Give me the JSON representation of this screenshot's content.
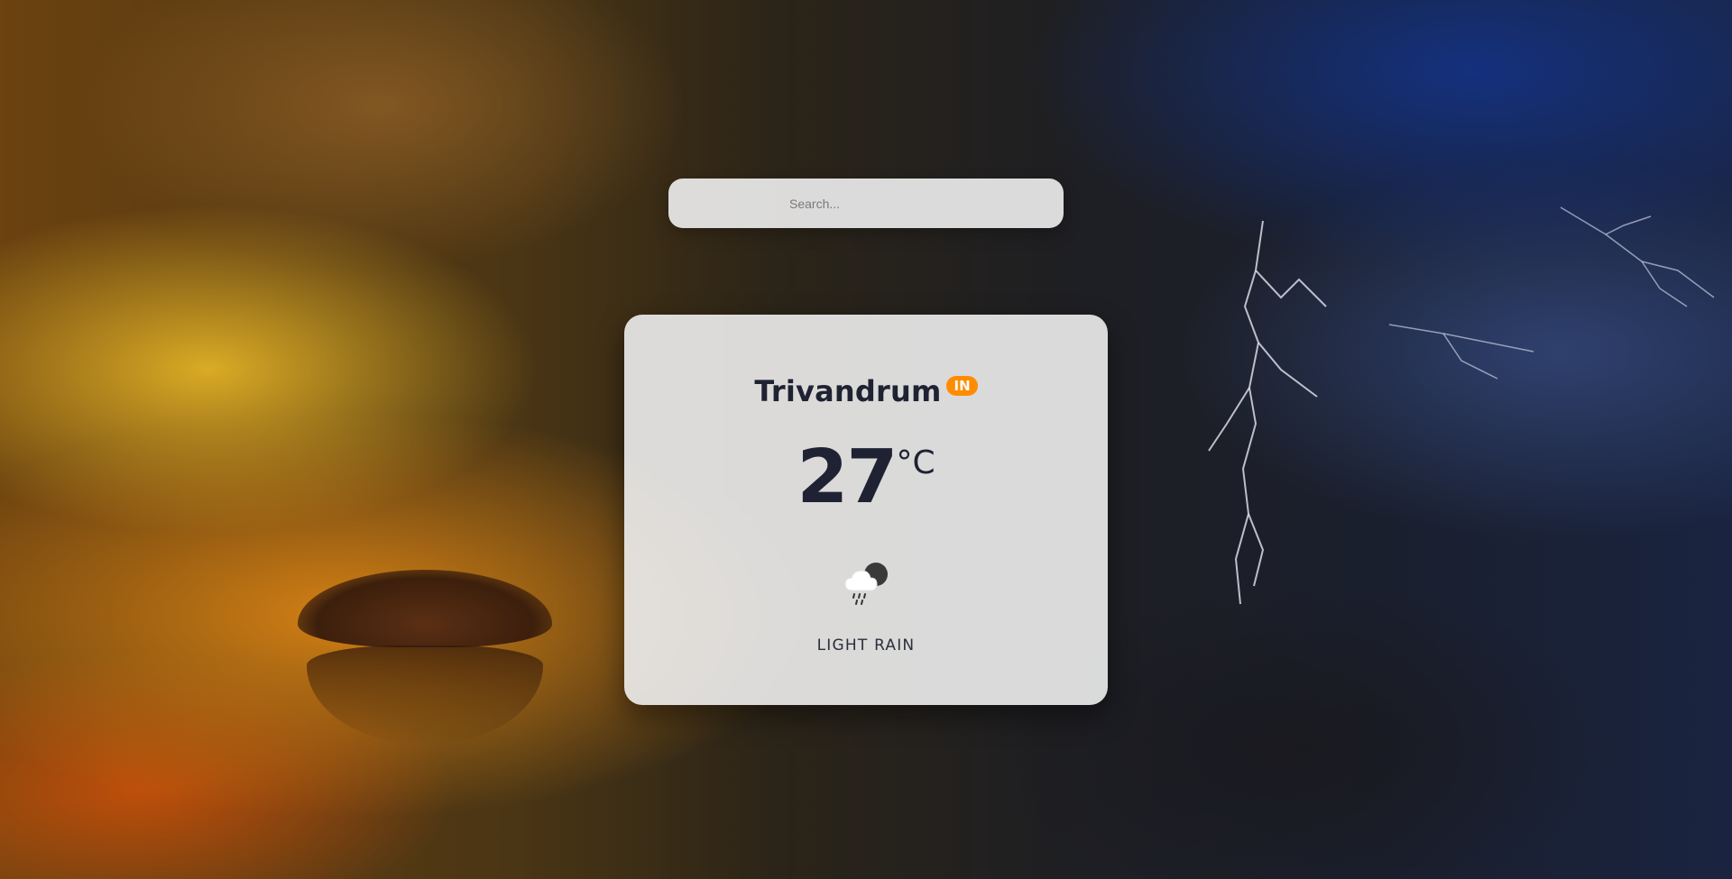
{
  "search": {
    "placeholder": "Search..."
  },
  "weather": {
    "city": "Trivandrum",
    "country_code": "IN",
    "temperature": "27",
    "unit": "°C",
    "icon": "night-light-rain-icon",
    "description": "LIGHT RAIN"
  },
  "colors": {
    "badge": "#ff8c00",
    "text": "#1e2232",
    "card": "#eeeeee"
  }
}
